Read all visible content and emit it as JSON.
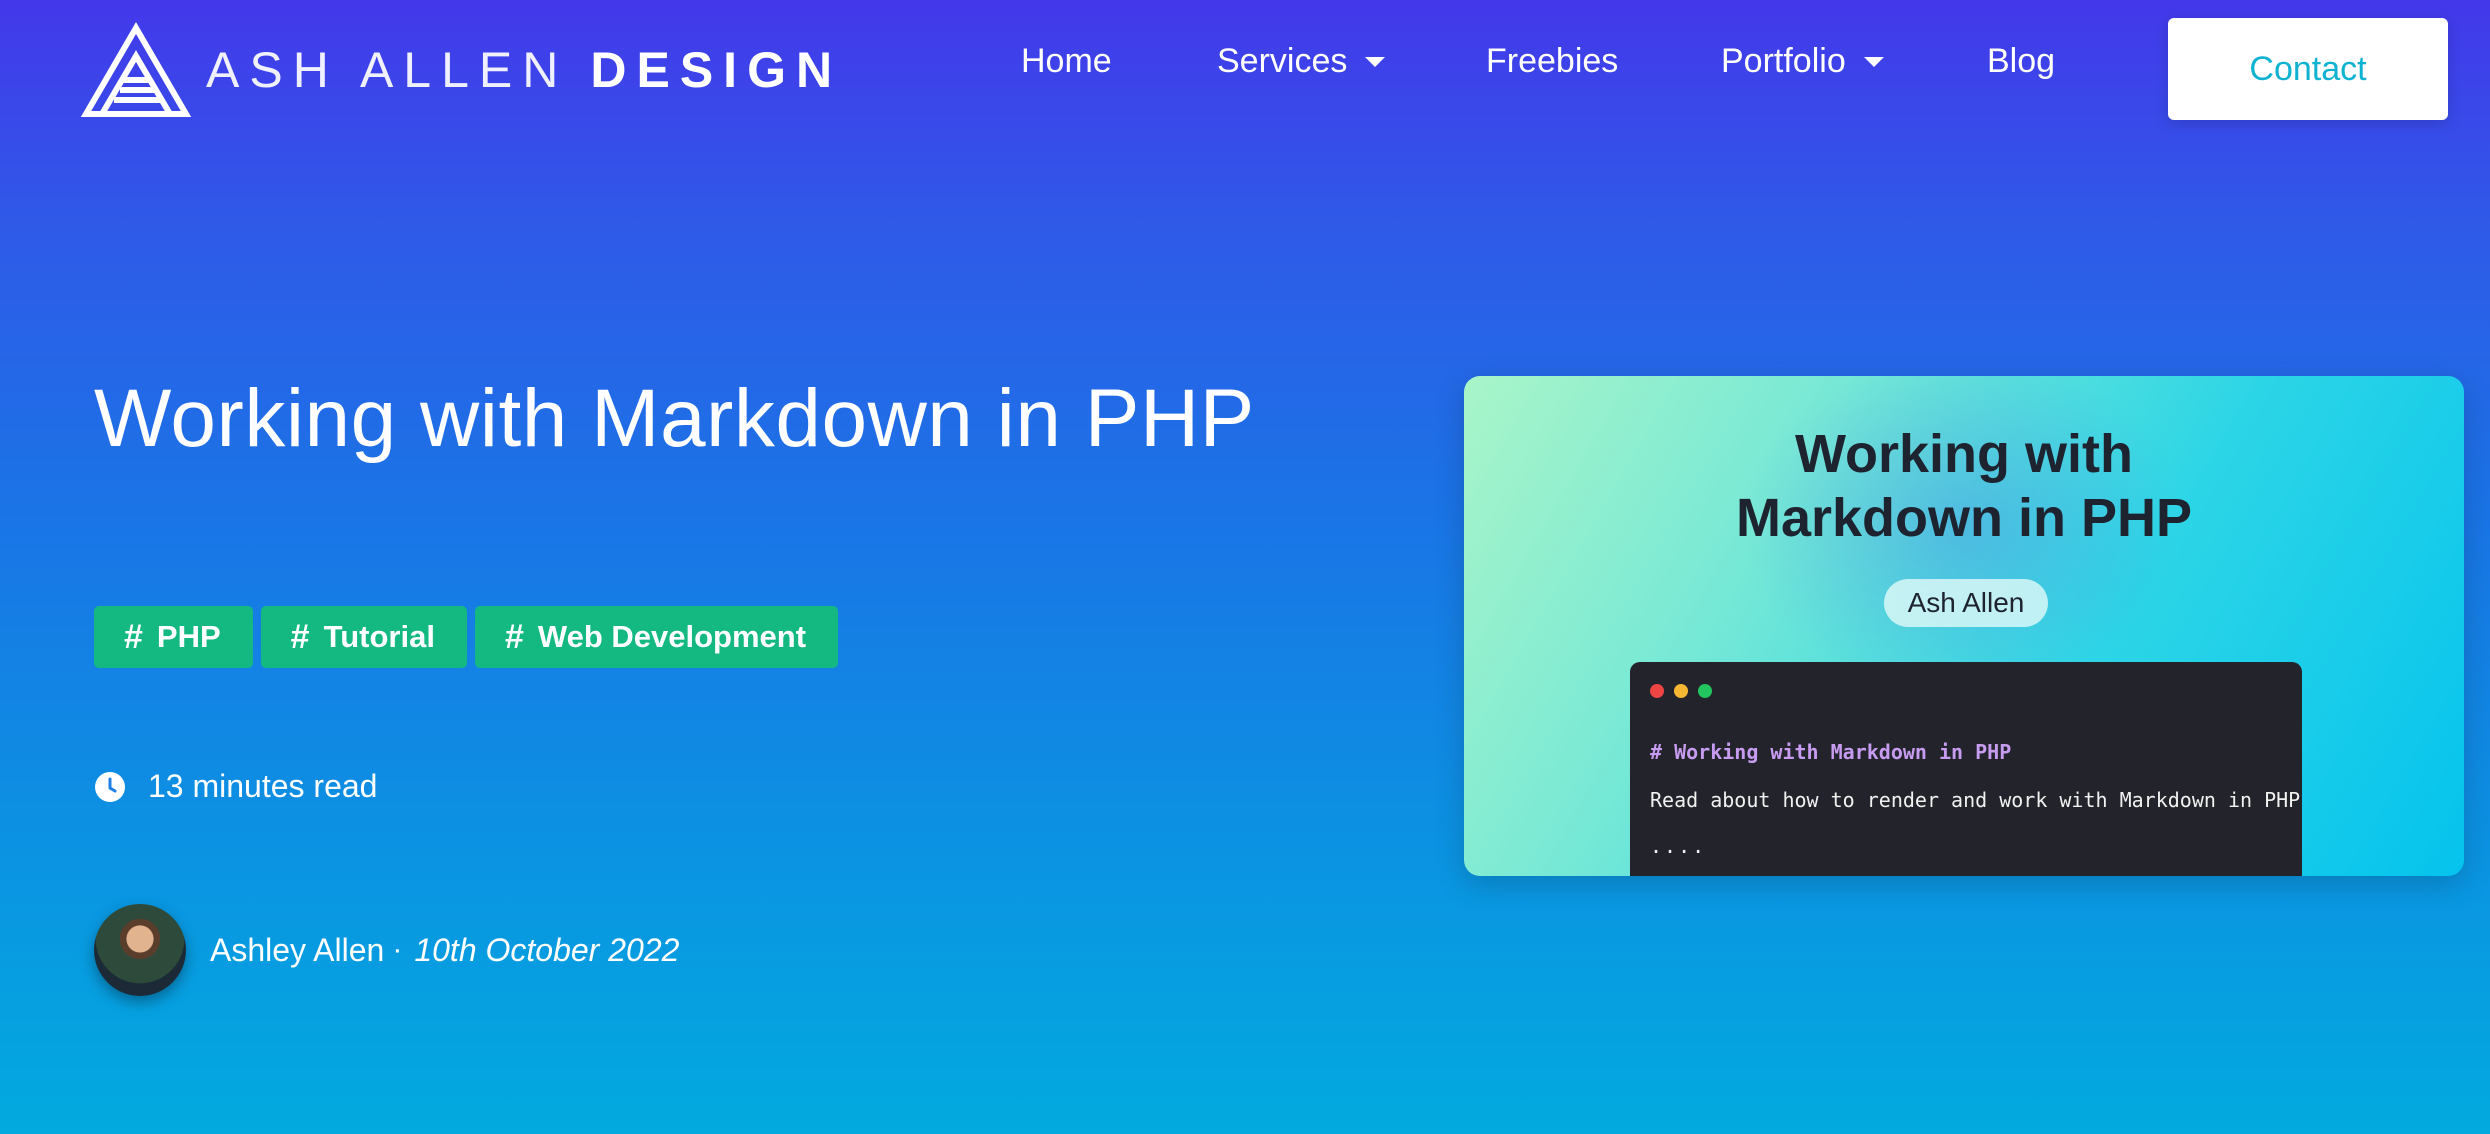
{
  "header": {
    "logo": {
      "light_text": "ASH ALLEN",
      "bold_text": "DESIGN"
    },
    "nav": [
      {
        "label": "Home",
        "has_dropdown": false
      },
      {
        "label": "Services",
        "has_dropdown": true
      },
      {
        "label": "Freebies",
        "has_dropdown": false
      },
      {
        "label": "Portfolio",
        "has_dropdown": true
      },
      {
        "label": "Blog",
        "has_dropdown": false
      }
    ],
    "contact_label": "Contact"
  },
  "article": {
    "title": "Working with Markdown in PHP",
    "tags": [
      {
        "icon": "hash-icon",
        "label": "PHP"
      },
      {
        "icon": "hash-icon",
        "label": "Tutorial"
      },
      {
        "icon": "hash-icon",
        "label": "Web Development"
      }
    ],
    "read_time": "13 minutes read",
    "author": {
      "name": "Ashley Allen",
      "separator": "·",
      "date": "10th October 2022"
    }
  },
  "featured_image": {
    "title_line1": "Working with",
    "title_line2": "Markdown in PHP",
    "badge": "Ash Allen",
    "code": {
      "heading": "# Working with Markdown in PHP",
      "paragraph": "Read about how to render and work with Markdown in PHP",
      "ellipsis": "...."
    }
  },
  "colors": {
    "tag_green": "#14b981",
    "contact_text": "#0fb3d1",
    "dot_red": "#ef4444",
    "dot_yellow": "#f5b731",
    "dot_green": "#22c55e"
  }
}
